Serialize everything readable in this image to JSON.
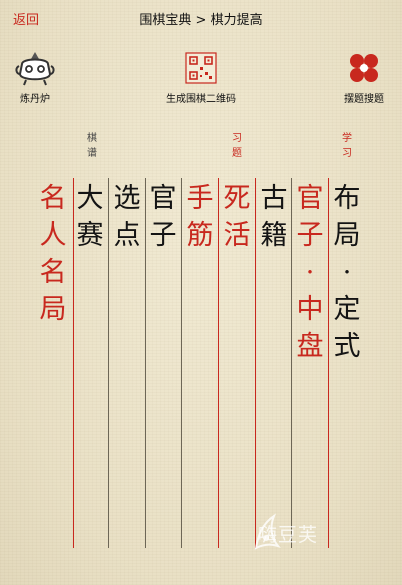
{
  "header": {
    "back_label": "返回",
    "title": "围棋宝典 > 棋力提高"
  },
  "tools": {
    "left": {
      "label": "炼丹炉",
      "icon": "alchemy-furnace-icon"
    },
    "middle": {
      "label": "生成围棋二维码",
      "icon": "qr-code-icon"
    },
    "right": {
      "label": "摆题搜题",
      "icon": "go-stones-icon"
    }
  },
  "section_headers": {
    "qipu": "棋谱",
    "xiti": "习题",
    "xuexi": "学习"
  },
  "columns": {
    "mingren": "名人名局",
    "dasai": "大赛",
    "xuandian": "选点",
    "guanzi": "官子",
    "shoujin": "手筋",
    "sihuo": "死活",
    "guji": "古籍",
    "guanzi_zhongpan": "官子·中盘",
    "buju_dingshi": "布局·定式"
  },
  "watermark": "嗨豆芙",
  "colors": {
    "accent_red": "#c8281e",
    "ink": "#141414",
    "paper": "#ece4cc"
  }
}
